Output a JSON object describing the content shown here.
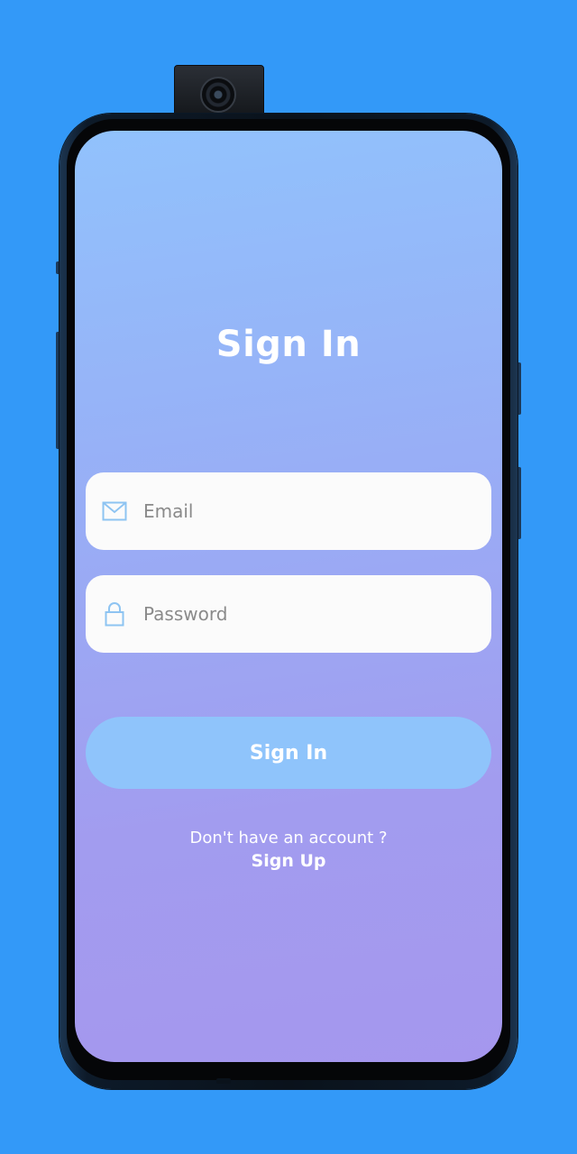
{
  "screen": {
    "title": "Sign In"
  },
  "form": {
    "email": {
      "placeholder": "Email",
      "value": "",
      "icon": "mail-icon"
    },
    "password": {
      "placeholder": "Password",
      "value": "",
      "icon": "lock-icon"
    },
    "submit_label": "Sign In"
  },
  "footer": {
    "prompt": "Don't have an account ?",
    "signup_label": "Sign Up"
  },
  "colors": {
    "page_background": "#3399f8",
    "screen_gradient_top": "#91c2fc",
    "screen_gradient_bottom": "#a597ee",
    "button": "#8fc4fb",
    "icon": "#8ec4f2"
  }
}
